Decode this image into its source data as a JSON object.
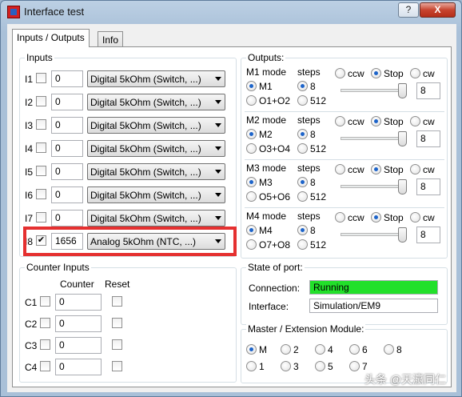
{
  "window": {
    "title": "Interface test",
    "help_label": "?",
    "close_label": "X"
  },
  "tabs": [
    "Inputs / Outputs",
    "Info"
  ],
  "inputs": {
    "title": "Inputs",
    "rows": [
      {
        "label": "I1",
        "checked": false,
        "value": "0",
        "mode": "Digital 5kOhm (Switch, ...)"
      },
      {
        "label": "I2",
        "checked": false,
        "value": "0",
        "mode": "Digital 5kOhm (Switch, ...)"
      },
      {
        "label": "I3",
        "checked": false,
        "value": "0",
        "mode": "Digital 5kOhm (Switch, ...)"
      },
      {
        "label": "I4",
        "checked": false,
        "value": "0",
        "mode": "Digital 5kOhm (Switch, ...)"
      },
      {
        "label": "I5",
        "checked": false,
        "value": "0",
        "mode": "Digital 5kOhm (Switch, ...)"
      },
      {
        "label": "I6",
        "checked": false,
        "value": "0",
        "mode": "Digital 5kOhm (Switch, ...)"
      },
      {
        "label": "I7",
        "checked": false,
        "value": "0",
        "mode": "Digital 5kOhm (Switch, ...)"
      },
      {
        "label": "I8",
        "checked": true,
        "value": "1656",
        "mode": "Analog 5kOhm (NTC, ...)"
      }
    ],
    "highlight_color": "#e53030"
  },
  "counters": {
    "title": "Counter Inputs",
    "col_counter": "Counter",
    "col_reset": "Reset",
    "rows": [
      {
        "label": "C1",
        "value": "0"
      },
      {
        "label": "C2",
        "value": "0"
      },
      {
        "label": "C3",
        "value": "0"
      },
      {
        "label": "C4",
        "value": "0"
      }
    ]
  },
  "outputs": {
    "title": "Outputs:",
    "steps_label": "steps",
    "ccw_label": "ccw",
    "stop_label": "Stop",
    "cw_label": "cw",
    "motors": [
      {
        "mode_label": "M1 mode",
        "opt_motor": "M1",
        "opt_pair": "O1+O2",
        "steps_a": "8",
        "steps_b": "512",
        "value": "8",
        "slider_fraction": 1.0
      },
      {
        "mode_label": "M2 mode",
        "opt_motor": "M2",
        "opt_pair": "O3+O4",
        "steps_a": "8",
        "steps_b": "512",
        "value": "8",
        "slider_fraction": 1.0
      },
      {
        "mode_label": "M3 mode",
        "opt_motor": "M3",
        "opt_pair": "O5+O6",
        "steps_a": "8",
        "steps_b": "512",
        "value": "8",
        "slider_fraction": 1.0
      },
      {
        "mode_label": "M4 mode",
        "opt_motor": "M4",
        "opt_pair": "O7+O8",
        "steps_a": "8",
        "steps_b": "512",
        "value": "8",
        "slider_fraction": 1.0
      }
    ]
  },
  "port_state": {
    "title": "State of port:",
    "connection_label": "Connection:",
    "connection_value": "Running",
    "connection_color": "#22e02a",
    "interface_label": "Interface:",
    "interface_value": "Simulation/EM9"
  },
  "master": {
    "title": "Master / Extension Module:",
    "options": [
      "M",
      "2",
      "4",
      "6",
      "8",
      "1",
      "3",
      "5",
      "7"
    ],
    "selected": "M"
  },
  "watermark": "头条 @天瀛同仁"
}
